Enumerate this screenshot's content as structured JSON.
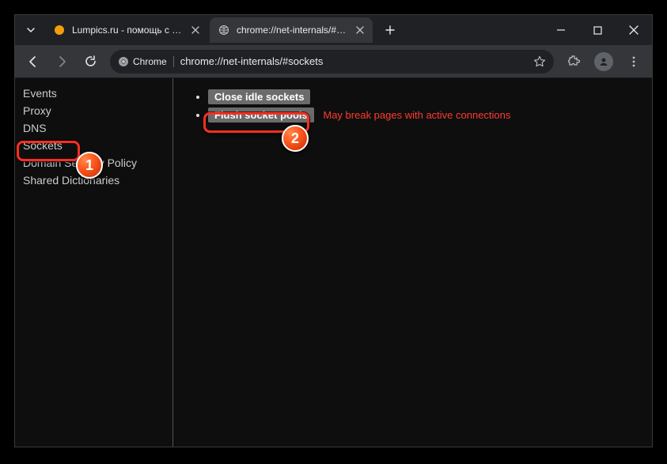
{
  "tabs": [
    {
      "title": "Lumpics.ru - помощь с компь",
      "favicon": "orange-dot"
    },
    {
      "title": "chrome://net-internals/#sockets",
      "favicon": "globe"
    }
  ],
  "omnibox": {
    "chip_label": "Chrome",
    "url": "chrome://net-internals/#sockets"
  },
  "sidebar": {
    "items": [
      "Events",
      "Proxy",
      "DNS",
      "Sockets",
      "Domain Security Policy",
      "Shared Dictionaries"
    ],
    "selected_index": 3
  },
  "actions": {
    "close_idle": "Close idle sockets",
    "flush_pools": "Flush socket pools",
    "flush_warning": "May break pages with active connections"
  },
  "annotations": {
    "badge1": "1",
    "badge2": "2"
  }
}
